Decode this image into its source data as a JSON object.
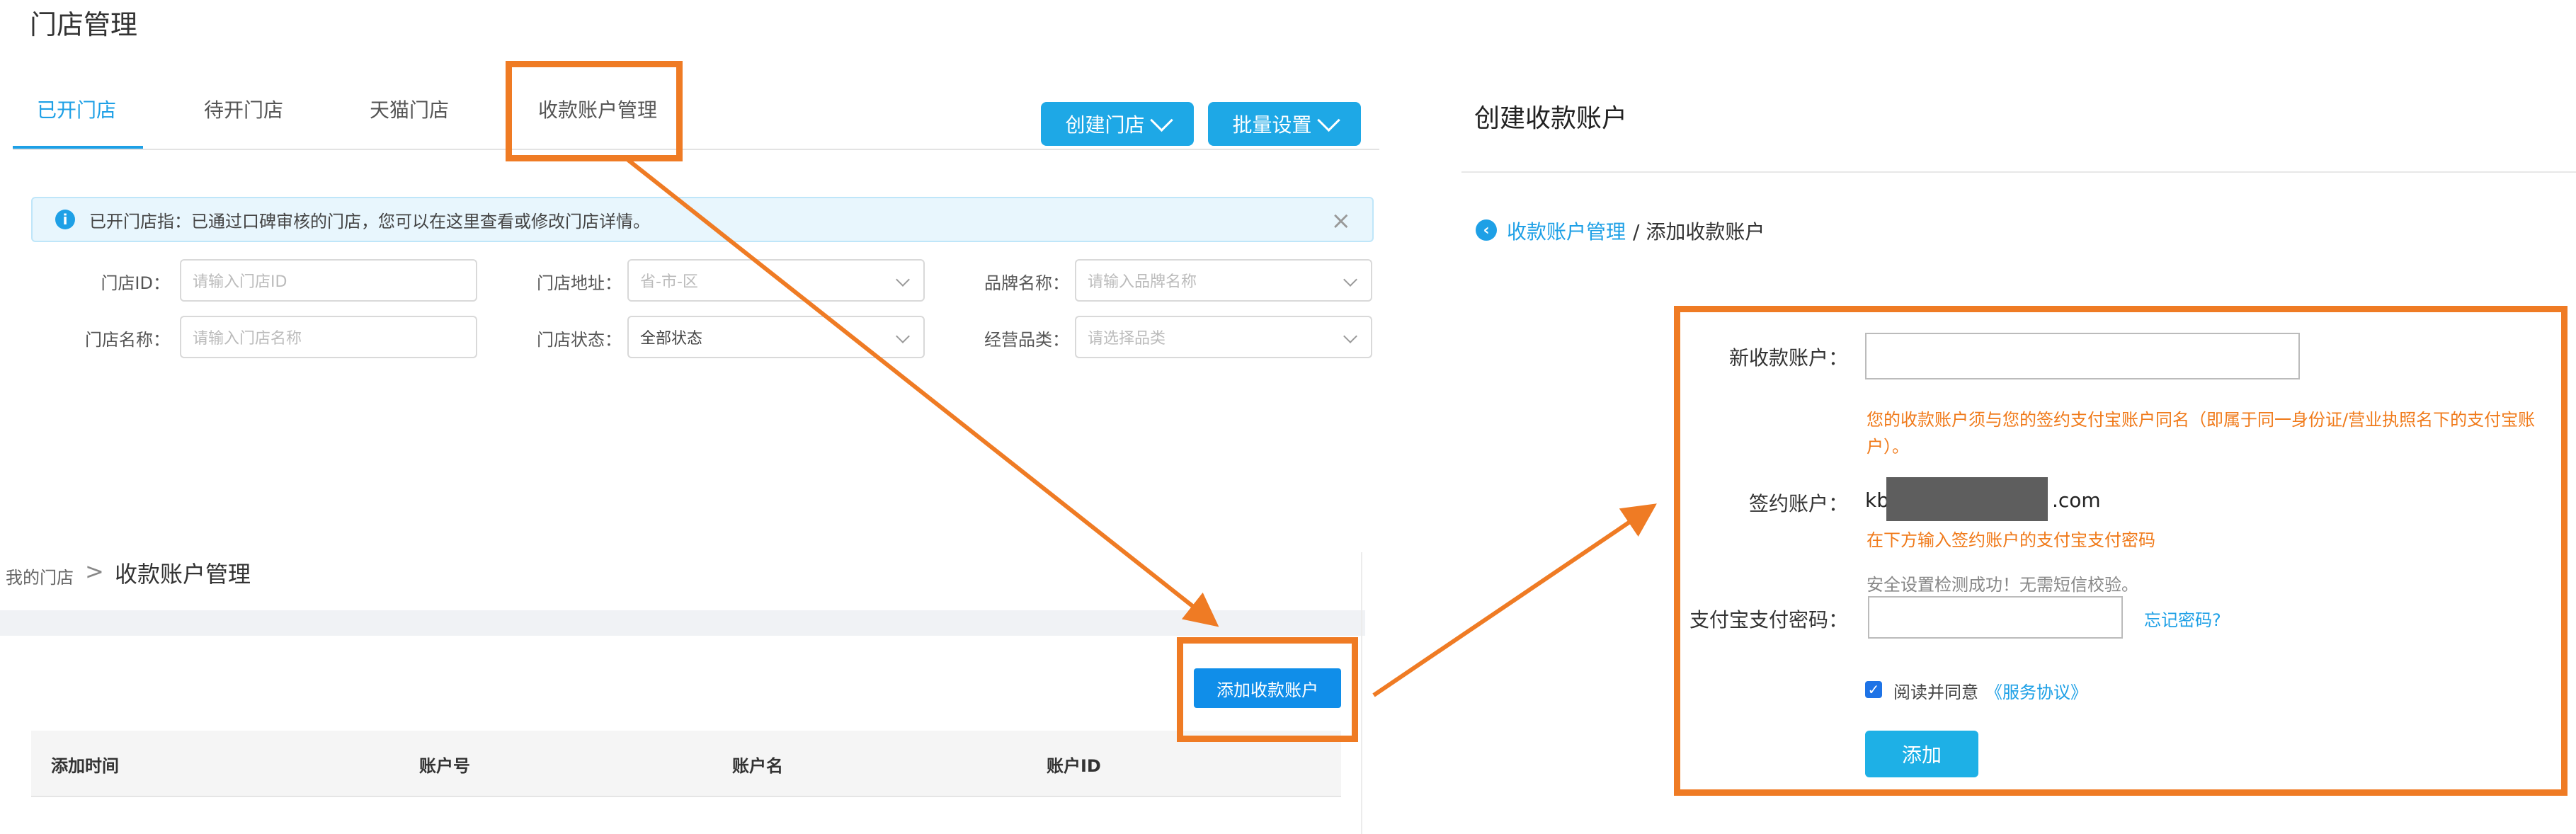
{
  "page_title": "门店管理",
  "tabs": [
    {
      "label": "已开门店",
      "active": true
    },
    {
      "label": "待开门店"
    },
    {
      "label": "天猫门店"
    },
    {
      "label": "收款账户管理"
    }
  ],
  "header_buttons": {
    "create_store": "创建门店",
    "batch_settings": "批量设置"
  },
  "info_bar": {
    "text": "已开门店指：已通过口碑审核的门店，您可以在这里查看或修改门店详情。",
    "close": "×"
  },
  "filters": {
    "store_id": {
      "label": "门店ID：",
      "placeholder": "请输入门店ID"
    },
    "store_address": {
      "label": "门店地址：",
      "placeholder": "省-市-区"
    },
    "brand_name": {
      "label": "品牌名称：",
      "placeholder": "请输入品牌名称"
    },
    "store_name": {
      "label": "门店名称：",
      "placeholder": "请输入门店名称"
    },
    "store_status": {
      "label": "门店状态：",
      "value": "全部状态"
    },
    "business_category": {
      "label": "经营品类：",
      "placeholder": "请选择品类"
    }
  },
  "account_mgmt": {
    "breadcrumb_parent": "我的门店",
    "breadcrumb_sep": ">",
    "breadcrumb_current": "收款账户管理",
    "add_button": "添加收款账户",
    "columns": [
      "添加时间",
      "账户号",
      "账户名",
      "账户ID"
    ]
  },
  "create_account": {
    "title": "创建收款账户",
    "breadcrumb_link": "收款账户管理",
    "breadcrumb_rest": "/ 添加收款账户",
    "new_account_label": "新收款账户：",
    "warning_line1": "您的收款账户须与您的签约支付宝账户同名（即属于同一身份证/营业执照名下的支付宝账",
    "warning_line2": "户）。",
    "signed_account_label": "签约账户：",
    "signed_account_prefix": "kb",
    "signed_account_suffix": ".com",
    "password_instruction": "在下方输入签约账户的支付宝支付密码",
    "security_ok": "安全设置检测成功！无需短信校验。",
    "password_label": "支付宝支付密码：",
    "forgot_password": "忘记密码?",
    "agree_text": "阅读并同意",
    "agreement_link": "《服务协议》",
    "submit": "添加"
  }
}
